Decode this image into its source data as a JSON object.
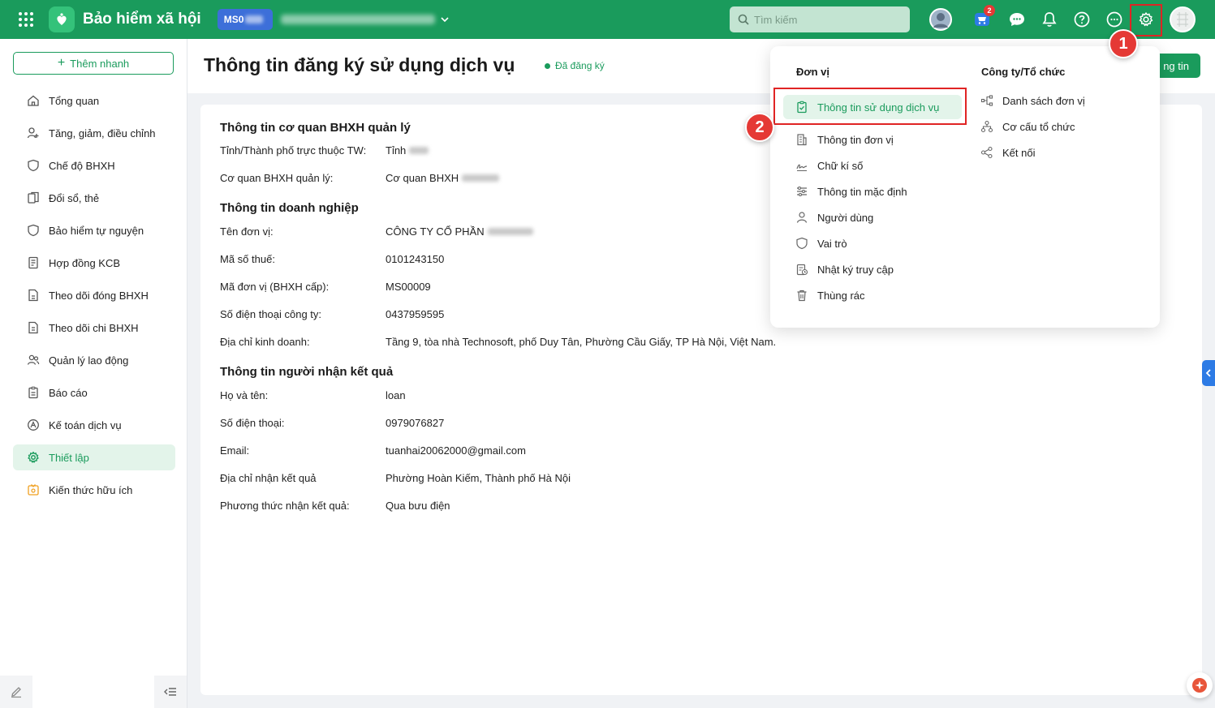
{
  "topbar": {
    "app_title": "Bảo hiểm xã hội",
    "unit_code": "MS0",
    "search_placeholder": "Tìm kiếm",
    "cart_badge": "2"
  },
  "sidebar": {
    "quick_add": "Thêm nhanh",
    "items": [
      {
        "label": "Tổng quan",
        "icon": "home-icon"
      },
      {
        "label": "Tăng, giảm, điều chỉnh",
        "icon": "user-adjust-icon"
      },
      {
        "label": "Chế độ BHXH",
        "icon": "shield-heart-icon"
      },
      {
        "label": "Đổi sổ, thẻ",
        "icon": "cards-icon"
      },
      {
        "label": "Bảo hiểm tự nguyện",
        "icon": "shield-icon"
      },
      {
        "label": "Hợp đồng KCB",
        "icon": "contract-icon"
      },
      {
        "label": "Theo dõi đóng BHXH",
        "icon": "doc-calendar-icon"
      },
      {
        "label": "Theo dõi chi BHXH",
        "icon": "doc-money-icon"
      },
      {
        "label": "Quản lý lao động",
        "icon": "users-icon"
      },
      {
        "label": "Báo cáo",
        "icon": "clipboard-icon"
      },
      {
        "label": "Kế toán dịch vụ",
        "icon": "accounting-icon"
      },
      {
        "label": "Thiết lập",
        "icon": "gear-icon"
      },
      {
        "label": "Kiến thức hữu ích",
        "icon": "knowledge-icon"
      }
    ]
  },
  "header": {
    "title": "Thông tin đăng ký sử dụng dịch vụ",
    "status": "Đã đăng ký",
    "action_label": "ng tin"
  },
  "content": {
    "section1": {
      "title": "Thông tin cơ quan BHXH quản lý",
      "rows": [
        {
          "label": "Tỉnh/Thành phố trực thuộc TW:",
          "value": "Tỉnh"
        },
        {
          "label": "Cơ quan BHXH quản lý:",
          "value": "Cơ quan BHXH"
        }
      ]
    },
    "section2": {
      "title": "Thông tin doanh nghiệp",
      "rows": [
        {
          "label": "Tên đơn vị:",
          "value": "CÔNG TY CỔ PHẦN"
        },
        {
          "label": "Mã số thuế:",
          "value": "0101243150"
        },
        {
          "label": "Mã đơn vị (BHXH cấp):",
          "value": "MS00009"
        },
        {
          "label": "Số điện thoại công ty:",
          "value": "0437959595"
        },
        {
          "label": "Địa chỉ kinh doanh:",
          "value": "Tầng 9, tòa nhà Technosoft, phố Duy Tân, Phường Cầu Giấy, TP Hà Nội, Việt Nam."
        }
      ]
    },
    "section3": {
      "title": "Thông tin người nhận kết quả",
      "rows": [
        {
          "label": "Họ và tên:",
          "value": "loan"
        },
        {
          "label": "Số điện thoại:",
          "value": "0979076827"
        },
        {
          "label": "Email:",
          "value": "tuanhai20062000@gmail.com"
        },
        {
          "label": "Địa chỉ nhận kết quả",
          "value": "Phường Hoàn Kiếm, Thành phố Hà Nội"
        },
        {
          "label": "Phương thức nhận kết quả:",
          "value": "Qua bưu điện"
        }
      ]
    }
  },
  "dropdown": {
    "col1_title": "Đơn vị",
    "col1_items": [
      {
        "label": "Thông tin sử dụng dịch vụ",
        "icon": "clipboard-check-icon"
      },
      {
        "label": "Thông tin đơn vị",
        "icon": "building-icon"
      },
      {
        "label": "Chữ kí số",
        "icon": "signature-icon"
      },
      {
        "label": "Thông tin mặc định",
        "icon": "sliders-icon"
      },
      {
        "label": "Người dùng",
        "icon": "user-icon"
      },
      {
        "label": "Vai trò",
        "icon": "shield-icon"
      },
      {
        "label": "Nhật ký truy cập",
        "icon": "log-icon"
      },
      {
        "label": "Thùng rác",
        "icon": "trash-icon"
      }
    ],
    "col2_title": "Công ty/Tổ chức",
    "col2_items": [
      {
        "label": "Danh sách đơn vị",
        "icon": "branch-list-icon"
      },
      {
        "label": "Cơ cấu tổ chức",
        "icon": "org-chart-icon"
      },
      {
        "label": "Kết nối",
        "icon": "share-icon"
      }
    ]
  },
  "annotations": {
    "step1": "1",
    "step2": "2"
  },
  "colors": {
    "primary": "#1a9b5c",
    "accent_red": "#e53935",
    "chip_blue": "#3d6fd9"
  }
}
